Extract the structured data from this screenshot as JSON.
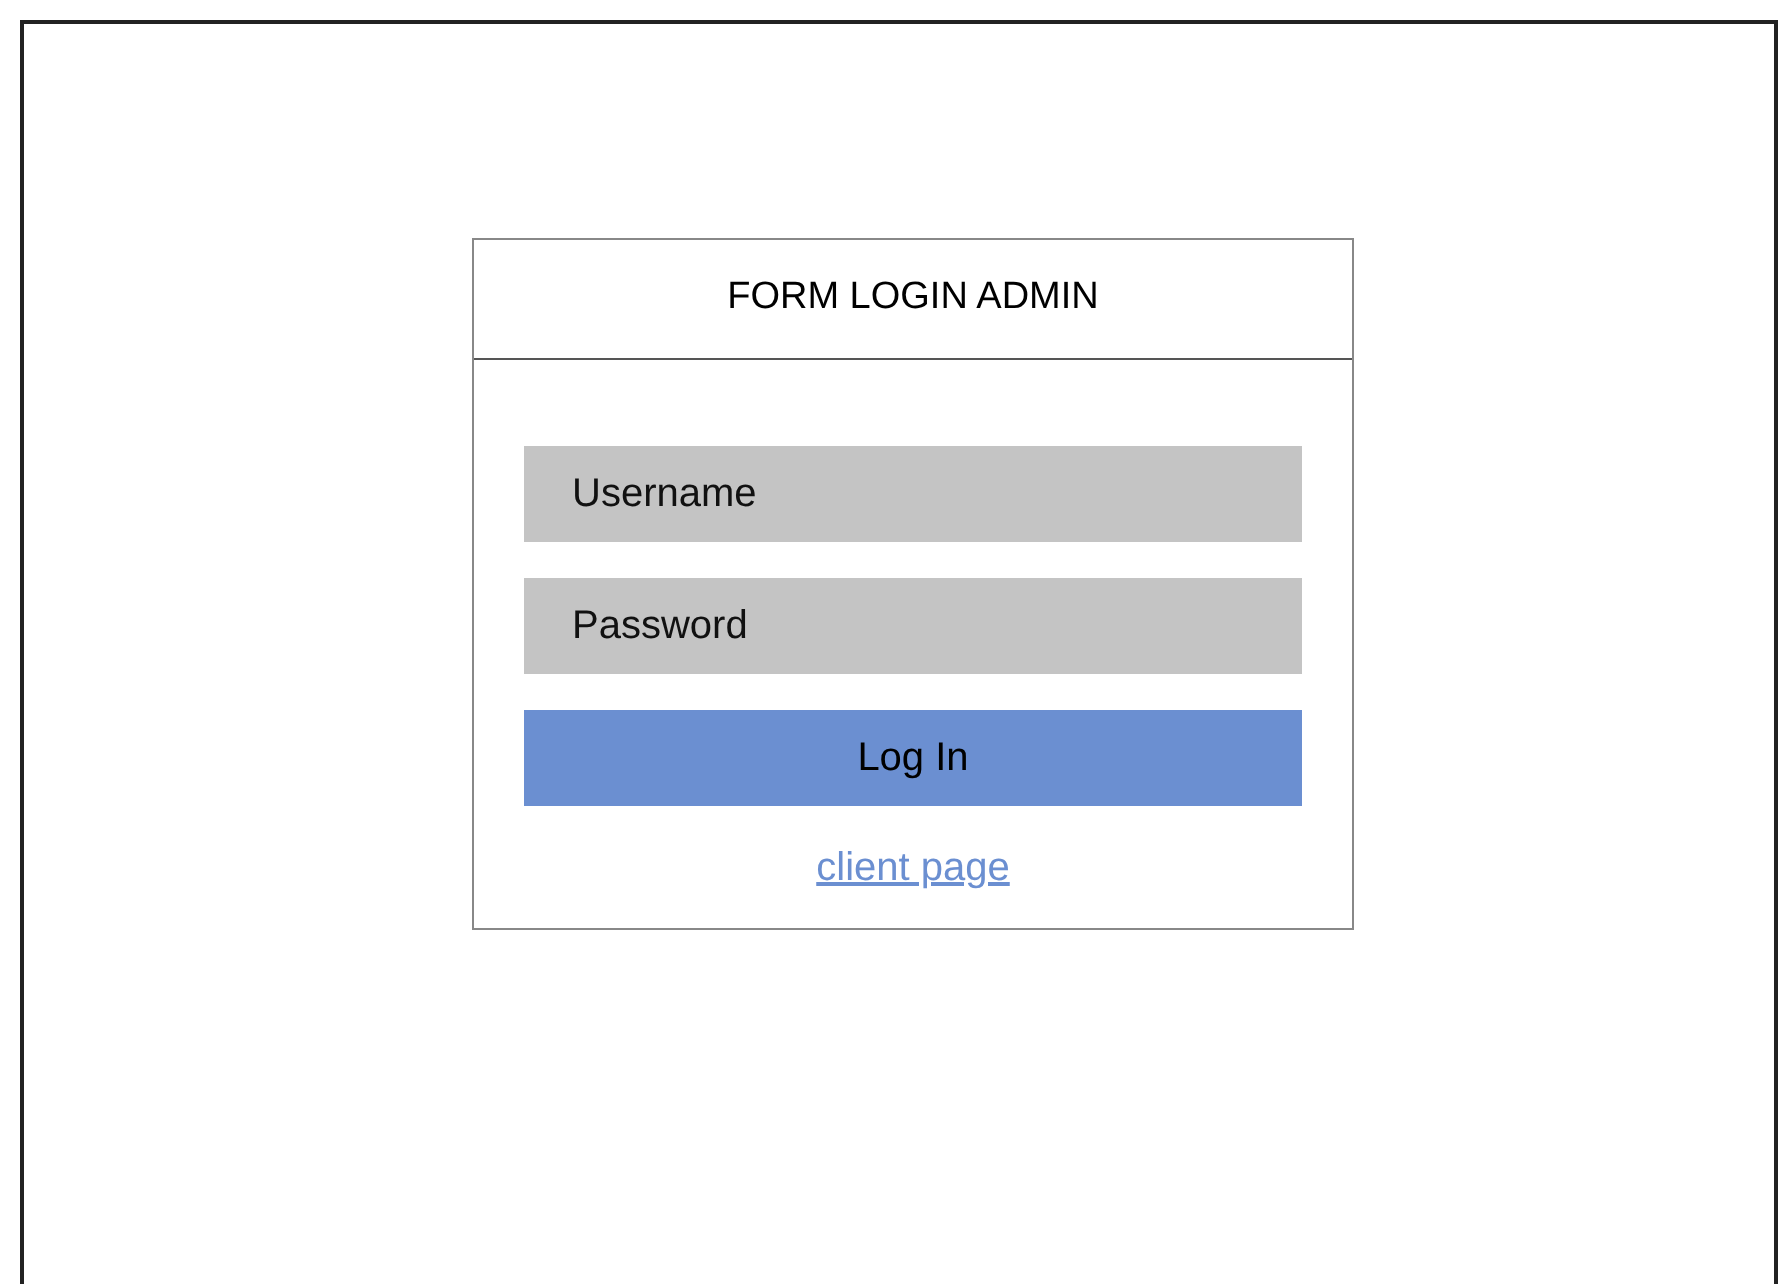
{
  "form": {
    "title": "FORM LOGIN ADMIN",
    "fields": [
      {
        "placeholder": "Username"
      },
      {
        "placeholder": "Password"
      }
    ],
    "button": "Log In",
    "link": "client page"
  }
}
